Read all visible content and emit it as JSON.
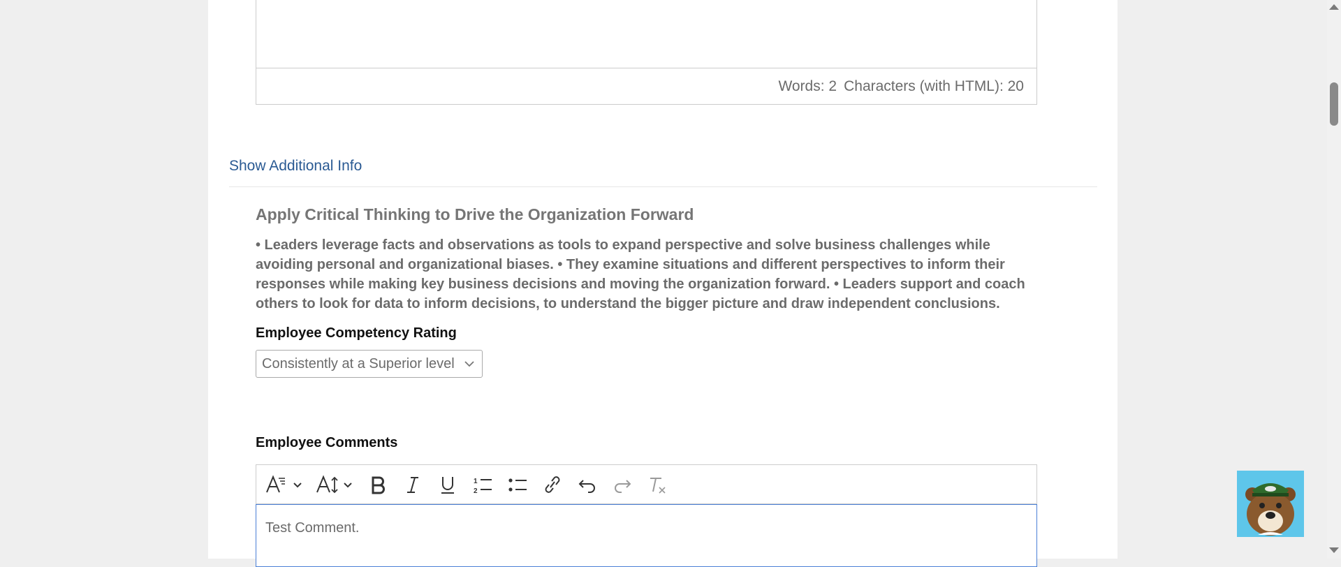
{
  "top_editor": {
    "words": "Words: 2",
    "characters": "Characters (with HTML): 20"
  },
  "show_additional_info": "Show Additional Info",
  "competency": {
    "title": "Apply Critical Thinking to Drive the Organization Forward",
    "description": "• Leaders leverage facts and observations as tools to expand perspective and solve business challenges while avoiding personal and organizational biases. • They examine situations and different perspectives to inform their responses while making key business decisions and moving the organization forward. • Leaders support and coach others to look for data to inform decisions, to understand the bigger picture and draw independent conclusions.",
    "rating_label": "Employee Competency Rating",
    "rating_value": "Consistently at a Superior level"
  },
  "comments": {
    "label": "Employee Comments",
    "text": "Test Comment.",
    "toolbar": [
      "font-style-icon",
      "font-size-icon",
      "bold-icon",
      "italic-icon",
      "underline-icon",
      "ordered-list-icon",
      "bullet-list-icon",
      "link-icon",
      "undo-icon",
      "redo-icon",
      "clear-format-icon"
    ]
  },
  "colors": {
    "link": "#2a5a93",
    "focus_border": "#4a7fd6",
    "mascot_bg": "#5ec6ea"
  }
}
